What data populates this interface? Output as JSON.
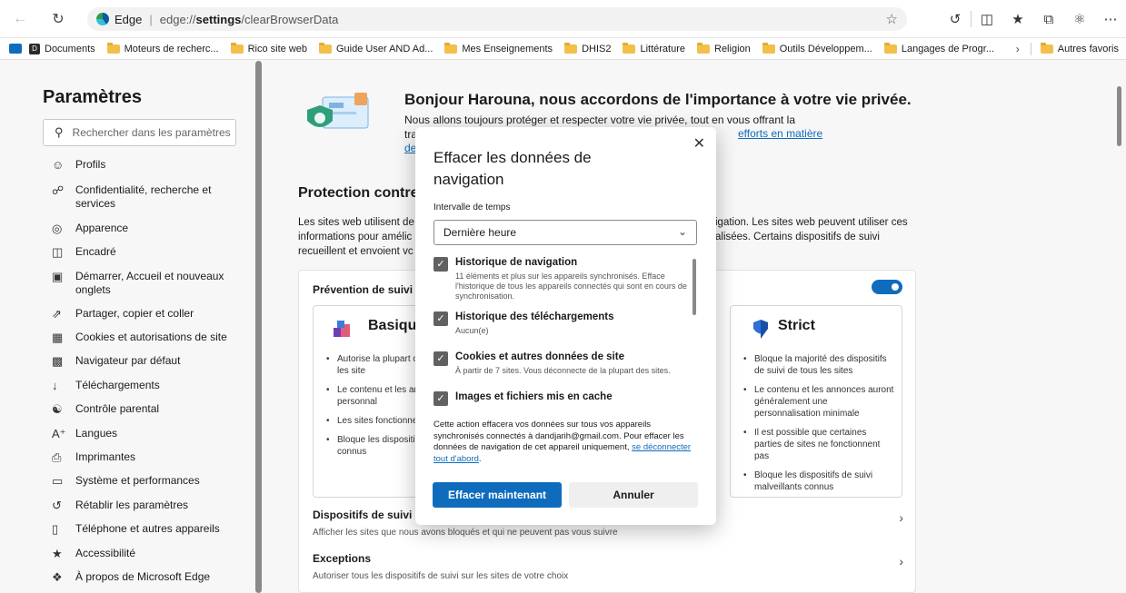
{
  "browser": {
    "address_prefix": "Edge",
    "address_url_path": "edge://",
    "address_url_bold": "settings",
    "address_url_rest": "/clearBrowserData"
  },
  "favorites": {
    "items": [
      {
        "label": "Documents",
        "icon": "docs-icon"
      },
      {
        "label": "Moteurs de recherc...",
        "icon": "folder-icon"
      },
      {
        "label": "Rico site web",
        "icon": "folder-icon"
      },
      {
        "label": "Guide User AND Ad...",
        "icon": "folder-icon"
      },
      {
        "label": "Mes Enseignements",
        "icon": "folder-icon"
      },
      {
        "label": "DHIS2",
        "icon": "folder-icon"
      },
      {
        "label": "Littérature",
        "icon": "folder-icon"
      },
      {
        "label": "Religion",
        "icon": "folder-icon"
      },
      {
        "label": "Outils Développem...",
        "icon": "folder-icon"
      },
      {
        "label": "Langages de Progr...",
        "icon": "folder-icon"
      }
    ],
    "other": "Autres favoris"
  },
  "sidebar": {
    "title": "Paramètres",
    "search_placeholder": "Rechercher dans les paramètres",
    "items": [
      {
        "label": "Profils",
        "icon": "profile-icon"
      },
      {
        "label": "Confidentialité, recherche et services",
        "icon": "lock-icon"
      },
      {
        "label": "Apparence",
        "icon": "palette-icon"
      },
      {
        "label": "Encadré",
        "icon": "sidebar-icon"
      },
      {
        "label": "Démarrer, Accueil et nouveaux onglets",
        "icon": "home-icon"
      },
      {
        "label": "Partager, copier et coller",
        "icon": "share-icon"
      },
      {
        "label": "Cookies et autorisations de site",
        "icon": "cookie-icon"
      },
      {
        "label": "Navigateur par défaut",
        "icon": "browser-icon"
      },
      {
        "label": "Téléchargements",
        "icon": "download-icon"
      },
      {
        "label": "Contrôle parental",
        "icon": "family-icon"
      },
      {
        "label": "Langues",
        "icon": "language-icon"
      },
      {
        "label": "Imprimantes",
        "icon": "printer-icon"
      },
      {
        "label": "Système et performances",
        "icon": "laptop-icon"
      },
      {
        "label": "Rétablir les paramètres",
        "icon": "reset-icon"
      },
      {
        "label": "Téléphone et autres appareils",
        "icon": "phone-icon"
      },
      {
        "label": "Accessibilité",
        "icon": "accessibility-icon"
      },
      {
        "label": "À propos de Microsoft Edge",
        "icon": "edge-icon"
      }
    ]
  },
  "main": {
    "hero_title": "Bonjour Harouna, nous accordons de l'importance à votre vie privée.",
    "hero_text_line1": "Nous allons toujours protéger et respecter votre vie privée, tout en vous offrant la",
    "hero_text_line2_start": "tra",
    "hero_link_right": "efforts en matière",
    "hero_link_left": "de",
    "section_title": "Protection contre",
    "section_text_left": [
      "Les sites web utilisent de",
      "informations pour amélic",
      "recueillent et envoient vc"
    ],
    "section_text_right": [
      "igation. Les sites web peuvent utiliser ces",
      "alisées. Certains dispositifs de suivi"
    ],
    "prevention_title": "Prévention de suivi",
    "basic": {
      "name": "Basique",
      "bullets": [
        "Autorise la plupart c suivi sur tous les site",
        "Le contenu et les an peut-être personnal",
        "Les sites fonctionne",
        "Bloque les dispositif malveillants connus"
      ]
    },
    "strict": {
      "name": "Strict",
      "bullets": [
        "Bloque la majorité des dispositifs de suivi de tous les sites",
        "Le contenu et les annonces auront généralement une personnalisation minimale",
        "Il est possible que certaines parties de sites ne fonctionnent pas",
        "Bloque les dispositifs de suivi malveillants connus"
      ]
    },
    "row1_title": "Dispositifs de suivi blo",
    "row1_sub": "Afficher les sites que nous avons bloqués et qui ne peuvent pas vous suivre",
    "row2_title": "Exceptions",
    "row2_sub": "Autoriser tous les dispositifs de suivi sur les sites de votre choix"
  },
  "dialog": {
    "title": "Effacer les données de navigation",
    "range_label": "Intervalle de temps",
    "range_value": "Dernière heure",
    "items": [
      {
        "title": "Historique de navigation",
        "sub": "11 éléments et plus sur les appareils synchronisés. Efface l'historique de tous les appareils connectés qui sont en cours de synchronisation.",
        "checked": true
      },
      {
        "title": "Historique des téléchargements",
        "sub": "Aucun(e)",
        "checked": true
      },
      {
        "title": "Cookies et autres données de site",
        "sub": "À partir de 7 sites. Vous déconnecte de la plupart des sites.",
        "checked": true
      },
      {
        "title": "Images et fichiers mis en cache",
        "sub": "",
        "checked": true
      }
    ],
    "info_text": "Cette action effacera vos données sur tous vos appareils synchronisés connectés à dandjarih@gmail.com. Pour effacer les données de navigation de cet appareil uniquement,",
    "info_link": "se déconnecter tout d'abord",
    "info_end": ".",
    "primary_button": "Effacer maintenant",
    "secondary_button": "Annuler"
  }
}
